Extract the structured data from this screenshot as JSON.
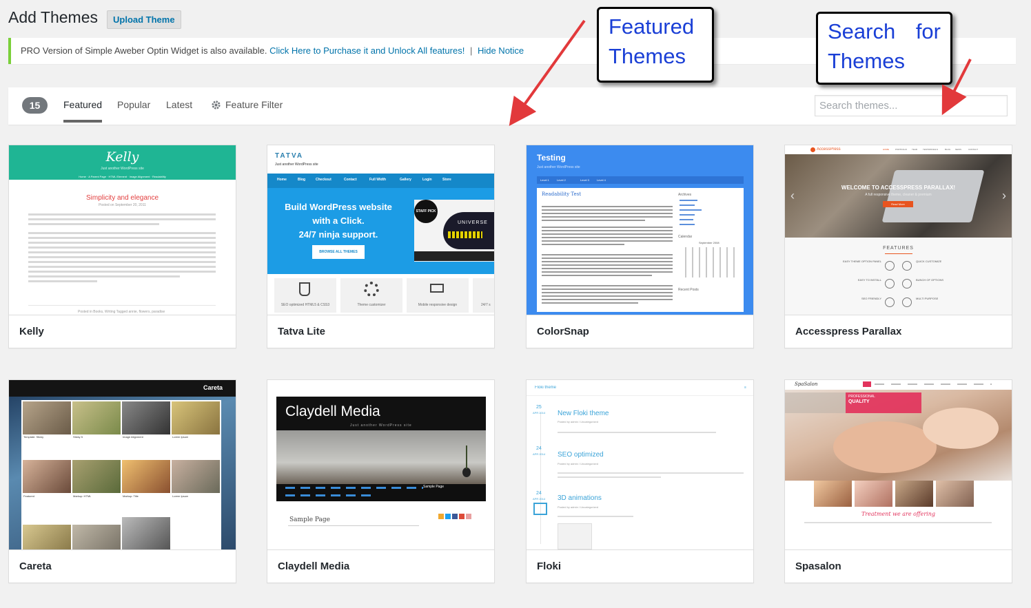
{
  "header": {
    "title": "Add Themes",
    "upload_label": "Upload Theme"
  },
  "notice": {
    "text": "PRO Version of Simple Aweber Optin Widget is also available.",
    "purchase_link": "Click Here to Purchase it and Unlock All features!",
    "separator": "|",
    "hide_link": "Hide Notice",
    "accent": "#7ad03a"
  },
  "filters": {
    "count": "15",
    "tabs": [
      {
        "label": "Featured",
        "active": true
      },
      {
        "label": "Popular"
      },
      {
        "label": "Latest"
      }
    ],
    "feature_filter": "Feature Filter",
    "search_placeholder": "Search themes..."
  },
  "annotations": {
    "featured_line1": "Featured",
    "featured_line2": "Themes",
    "search_line1": "Search",
    "search_line1b": "for",
    "search_line2": "Themes",
    "arrow_color": "#e2393b",
    "text_color": "#1a3fd6"
  },
  "themes": [
    {
      "name": "Kelly",
      "shot": {
        "logo": "Kelly",
        "tagline": "Just another WordPress site",
        "nav": "Home · A Parent Page · HTML Element · Image Alignment · Readability",
        "post_title": "Simplicity and elegance",
        "posted": "Posted on September 20, 2011",
        "footer": "Posted in Books, Writing   Tagged annie, flowers, paradise"
      }
    },
    {
      "name": "Tatva Lite",
      "shot": {
        "logo": "TATVA",
        "tagline": "Just another WordPress site",
        "nav": [
          "Home",
          "Blog",
          "Checkout",
          "Contact",
          "Full Width",
          "Gallery",
          "Login",
          "Store"
        ],
        "hero1": "Build WordPress website",
        "hero2": "with a Click.",
        "hero3": "24/7 ninja support.",
        "cta": "BROWSE ALL THEMES",
        "badge": "STAFF PICK",
        "video": "UNIVERSE",
        "features": [
          "SEO optimized HTML5 & CSS3",
          "Theme customizer",
          "Mobile responsive design",
          "24/7 s"
        ]
      }
    },
    {
      "name": "ColorSnap",
      "shot": {
        "site": "Testing",
        "tagline": "Just another WordPress site",
        "nav": [
          "Level 1",
          "Level 2",
          "Level 3",
          "Level 4"
        ],
        "post": "Readability Test",
        "sidebar": "Archives",
        "calendar": "Calendar",
        "month": "September 2008",
        "recent": "Recent Posts"
      }
    },
    {
      "name": "Accesspress Parallax",
      "shot": {
        "logo": "AccessPress",
        "nav": [
          "HOME",
          "PORTFOLIO",
          "TEAM",
          "TESTIMONIALS",
          "BLOG",
          "NEWS",
          "CONTACT"
        ],
        "welcome": "WELCOME TO ACCESSPRESS PARALLAX!",
        "sub": "A full responsive theme, cleaner & premium",
        "btn": "Read More",
        "features": "FEATURES",
        "items": [
          "EASY THEME OPTION PANEL",
          "QUICK CUSTOMIZE",
          "EASY TO INSTALL",
          "BUNCH OF OPTIONS",
          "SEO FRIENDLY",
          "MULTI PURPOSE"
        ]
      }
    },
    {
      "name": "Careta",
      "shot": {
        "logo": "Careta",
        "captions": [
          "Template: Sticky",
          "Sticky 5",
          "Image Alignment",
          "Lorem Ipsum",
          "Featured",
          "Markup: HTML",
          "Markup: Title",
          "Lorem Ipsum"
        ]
      }
    },
    {
      "name": "Claydell Media",
      "shot": {
        "title": "Claydell Media",
        "tagline": "Just another WordPress site",
        "nav_active": "Sample Page",
        "page": "Sample Page"
      }
    },
    {
      "name": "Floki",
      "shot": {
        "site": "Floki theme",
        "posts": [
          {
            "day": "25",
            "mon": "APR 2014",
            "title": "New Floki theme",
            "meta": "Posted by admin / Uncategorized"
          },
          {
            "day": "24",
            "mon": "APR 2014",
            "title": "SEO optimized",
            "meta": "Posted by admin / Uncategorized"
          },
          {
            "day": "24",
            "mon": "APR 2014",
            "title": "3D animations",
            "meta": "Posted by admin / Uncategorized"
          }
        ]
      }
    },
    {
      "name": "Spasalon",
      "shot": {
        "logo": "SpaSalon",
        "banner1": "PROFESSIONAL",
        "banner2": "QUALITY",
        "offering": "Treatment we are offering"
      }
    }
  ]
}
